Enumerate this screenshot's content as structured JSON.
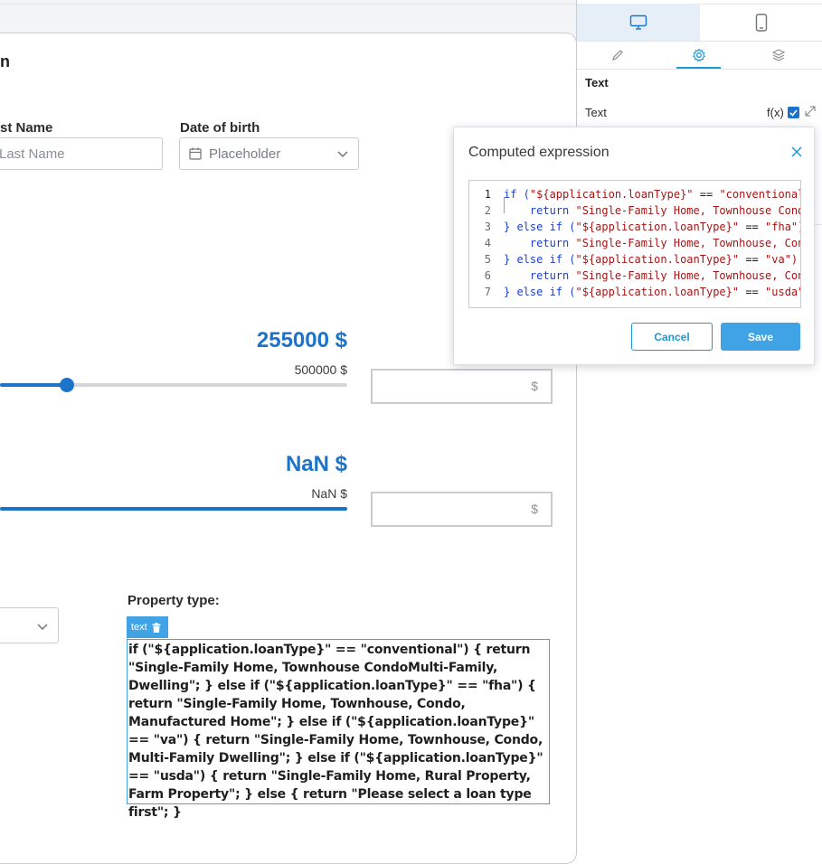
{
  "form": {
    "title": "n",
    "last_name_label": "st Name",
    "last_name_placeholder": "Last Name",
    "dob_label": "Date of birth",
    "dob_placeholder": "Placeholder",
    "loan_amount": "255000 $",
    "loan_max": "500000 $",
    "currency_unit_1": "$",
    "second_amount": "NaN $",
    "second_max": "NaN $",
    "currency_unit_2": "$",
    "slider_value": 255000,
    "slider_max": 500000,
    "property_type_label": "Property type:",
    "text_tag_label": "text",
    "property_text": "if (\"${application.loanType}\" == \"conventional\") { return \"Single-Family Home, Townhouse CondoMulti-Family, Dwelling\"; } else if (\"${application.loanType}\" == \"fha\") { return \"Single-Family Home, Townhouse, Condo, Manufactured Home\"; } else if (\"${application.loanType}\" == \"va\") { return \"Single-Family Home, Townhouse, Condo, Multi-Family Dwelling\"; } else if (\"${application.loanType}\" == \"usda\") { return \"Single-Family Home, Rural Property, Farm Property\"; } else { return \"Please select a loan type first\"; }"
  },
  "panel": {
    "device_tabs": [
      "desktop-icon",
      "mobile-icon"
    ],
    "tool_tabs": [
      "pencil-icon",
      "gear-icon",
      "layers-icon"
    ],
    "heading": "Text",
    "text_label": "Text",
    "fx_label": "f(x)",
    "fx_checked": true
  },
  "dialog": {
    "title": "Computed expression",
    "cancel_label": "Cancel",
    "save_label": "Save",
    "code_lines": [
      {
        "n": "1",
        "parts": [
          [
            "kw",
            "if ("
          ],
          [
            "str",
            "\"${application.loanType}\""
          ],
          [
            "plain",
            " == "
          ],
          [
            "str",
            "\"conventional\") {"
          ]
        ]
      },
      {
        "n": "2",
        "parts": [
          [
            "plain",
            "    "
          ],
          [
            "kw",
            "return "
          ],
          [
            "str",
            "\"Single-Family Home, Townhouse CondoMulti-Family, Dwelling\";"
          ]
        ]
      },
      {
        "n": "3",
        "parts": [
          [
            "kw",
            "} else if ("
          ],
          [
            "str",
            "\"${application.loanType}\""
          ],
          [
            "plain",
            " == "
          ],
          [
            "str",
            "\"fha\") {"
          ]
        ]
      },
      {
        "n": "4",
        "parts": [
          [
            "plain",
            "    "
          ],
          [
            "kw",
            "return "
          ],
          [
            "str",
            "\"Single-Family Home, Townhouse, Condo, Manufactured Home\";"
          ]
        ]
      },
      {
        "n": "5",
        "parts": [
          [
            "kw",
            "} else if ("
          ],
          [
            "str",
            "\"${application.loanType}\""
          ],
          [
            "plain",
            " == "
          ],
          [
            "str",
            "\"va\") {"
          ]
        ]
      },
      {
        "n": "6",
        "parts": [
          [
            "plain",
            "    "
          ],
          [
            "kw",
            "return "
          ],
          [
            "str",
            "\"Single-Family Home, Townhouse, Condo, Multi-Family Dwelling\";"
          ]
        ]
      },
      {
        "n": "7",
        "parts": [
          [
            "kw",
            "} else if ("
          ],
          [
            "str",
            "\"${application.loanType}\""
          ],
          [
            "plain",
            " == "
          ],
          [
            "str",
            "\"usda\") {"
          ]
        ]
      }
    ]
  },
  "colors": {
    "accent": "#1b74c9",
    "button": "#3fa3e5",
    "keyword": "#1a3fcc",
    "string": "#a31515"
  }
}
